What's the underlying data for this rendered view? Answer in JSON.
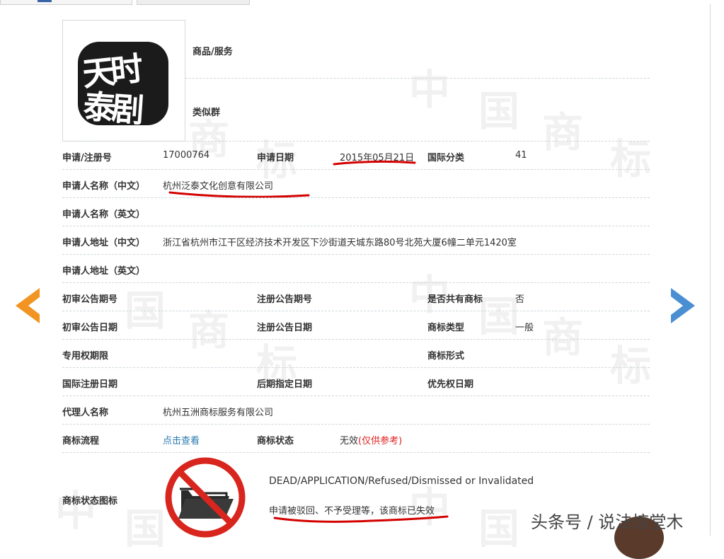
{
  "watermark": [
    "中",
    "国",
    "商",
    "标"
  ],
  "goods_services": "商品/服务",
  "similar_group": "类似群",
  "logo_text": "天时泰剧",
  "fields": {
    "reg_no_label": "申请/注册号",
    "reg_no_value": "17000764",
    "apply_date_label": "申请日期",
    "apply_date_value": "2015年05月21日",
    "intl_class_label": "国际分类",
    "intl_class_value": "41",
    "applicant_cn_label": "申请人名称（中文）",
    "applicant_cn_value": "杭州泛泰文化创意有限公司",
    "applicant_en_label": "申请人名称（英文）",
    "address_cn_label": "申请人地址（中文）",
    "address_cn_value": "浙江省杭州市江干区经济技术开发区下沙街道天城东路80号北苑大厦6幢二单元1420室",
    "address_en_label": "申请人地址（英文）",
    "prelim_pub_no_label": "初审公告期号",
    "reg_pub_no_label": "注册公告期号",
    "shared_label": "是否共有商标",
    "shared_value": "否",
    "prelim_pub_date_label": "初审公告日期",
    "reg_pub_date_label": "注册公告日期",
    "mark_type_label": "商标类型",
    "mark_type_value": "一般",
    "exclusive_period_label": "专用权期限",
    "mark_form_label": "商标形式",
    "intl_reg_date_label": "国际注册日期",
    "later_designation_label": "后期指定日期",
    "priority_date_label": "优先权日期",
    "agent_label": "代理人名称",
    "agent_value": "杭州五洲商标服务有限公司",
    "process_label": "商标流程",
    "process_link": "点击查看",
    "status_label": "商标状态",
    "status_value": "无效",
    "status_note": "(仅供参考)",
    "status_icon_label": "商标状态图标",
    "status_en": "DEAD/APPLICATION/Refused/Dismissed or Invalidated",
    "status_cn": "申请被驳回、不予受理等，该商标已失效"
  },
  "caption": "头条号 / 说法惊堂木",
  "colors": {
    "prev_arrow": "#f29422",
    "next_arrow": "#4a8fd2",
    "underline": "#d40000",
    "link": "#2a7ab0",
    "status_icon_ring": "#d8251d"
  }
}
